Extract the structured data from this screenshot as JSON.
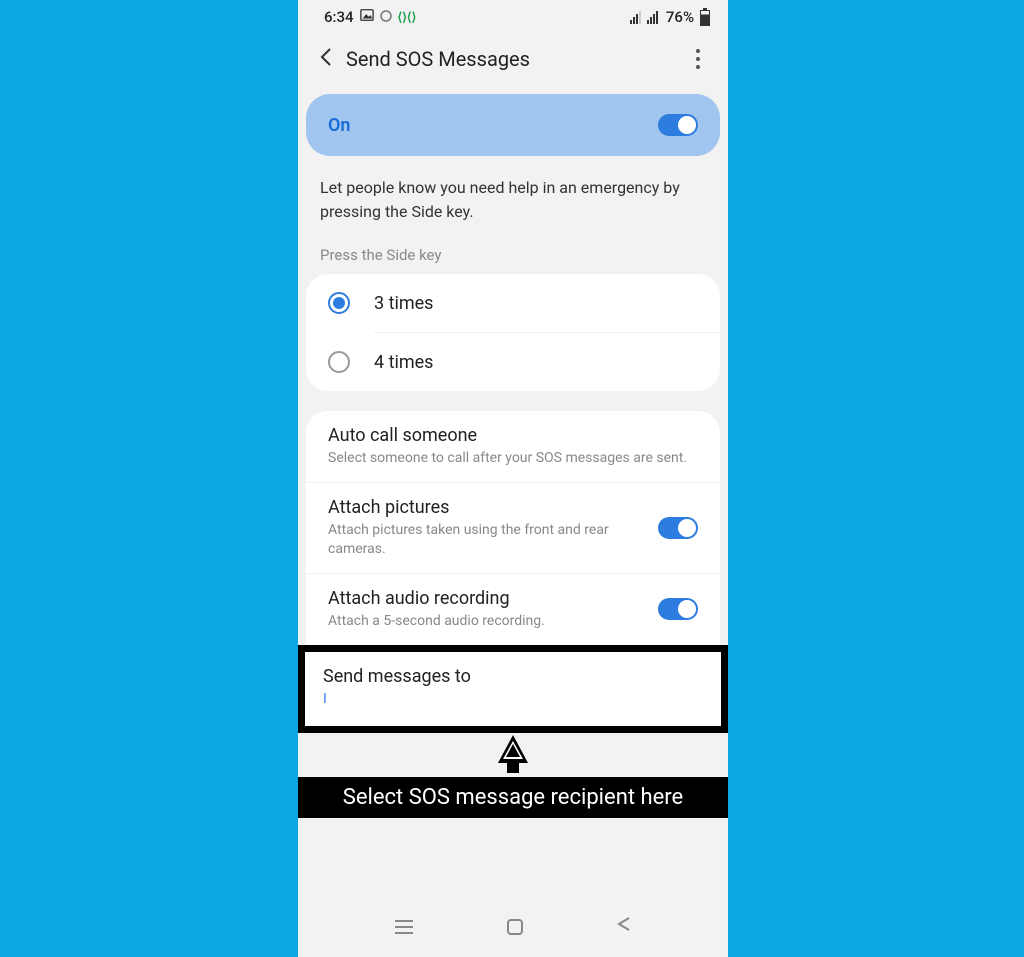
{
  "status_bar": {
    "time": "6:34",
    "battery": "76%"
  },
  "header": {
    "title": "Send SOS Messages"
  },
  "main_toggle": {
    "label": "On",
    "state": true
  },
  "description": "Let people know you need help in an emergency by pressing the Side key.",
  "press_section": {
    "label": "Press the Side key",
    "options": [
      {
        "label": "3 times",
        "selected": true
      },
      {
        "label": "4 times",
        "selected": false
      }
    ]
  },
  "settings": {
    "auto_call": {
      "title": "Auto call someone",
      "subtitle": "Select someone to call after your SOS messages are sent."
    },
    "attach_pictures": {
      "title": "Attach pictures",
      "subtitle": "Attach pictures taken using the front and rear cameras.",
      "toggle": true
    },
    "attach_audio": {
      "title": "Attach audio recording",
      "subtitle": "Attach a 5-second audio recording.",
      "toggle": true
    },
    "send_to": {
      "title": "Send messages to",
      "subtitle": "I"
    }
  },
  "callout": "Select SOS message recipient here"
}
